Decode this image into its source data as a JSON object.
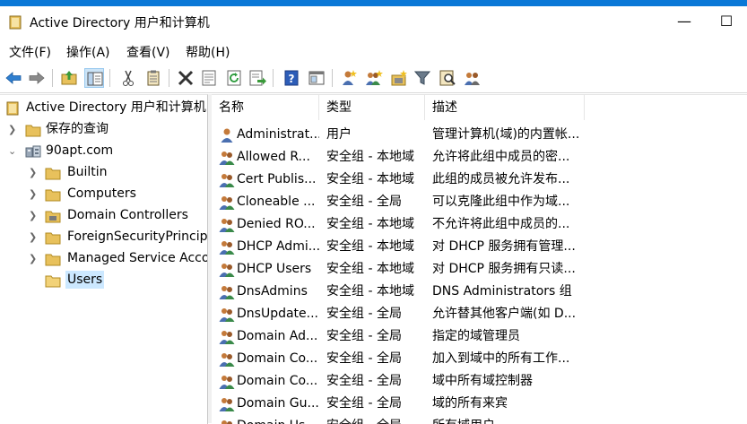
{
  "window": {
    "title": "Active Directory 用户和计算机",
    "minimize_glyph": "—",
    "maximize_glyph": "☐"
  },
  "menu": [
    {
      "label": "文件(F)"
    },
    {
      "label": "操作(A)"
    },
    {
      "label": "查看(V)"
    },
    {
      "label": "帮助(H)"
    }
  ],
  "toolbar": {
    "icons": [
      "back-arrow-icon",
      "forward-arrow-icon",
      "up-folder-icon",
      "show-hide-tree-icon",
      "cut-icon",
      "copy-icon",
      "delete-icon",
      "properties-icon",
      "refresh-icon",
      "export-list-icon",
      "help-icon",
      "console-icon",
      "new-user-icon",
      "new-group-icon",
      "new-ou-icon",
      "filter-icon",
      "find-icon",
      "add-to-group-icon"
    ]
  },
  "tree": {
    "root": "Active Directory 用户和计算机",
    "saved_queries": "保存的查询",
    "domain": "90apt.com",
    "children": [
      {
        "label": "Builtin",
        "selected": false
      },
      {
        "label": "Computers",
        "selected": false
      },
      {
        "label": "Domain Controllers",
        "selected": false
      },
      {
        "label": "ForeignSecurityPrincipals",
        "selected": false
      },
      {
        "label": "Managed Service Accounts",
        "selected": false
      },
      {
        "label": "Users",
        "selected": true
      }
    ]
  },
  "list": {
    "columns": [
      "名称",
      "类型",
      "描述"
    ],
    "rows": [
      {
        "icon": "user-icon",
        "name": "Administrat...",
        "type": "用户",
        "desc": "管理计算机(域)的内置帐..."
      },
      {
        "icon": "group-icon",
        "name": "Allowed R...",
        "type": "安全组 - 本地域",
        "desc": "允许将此组中成员的密..."
      },
      {
        "icon": "group-icon",
        "name": "Cert Publis...",
        "type": "安全组 - 本地域",
        "desc": "此组的成员被允许发布..."
      },
      {
        "icon": "group-icon",
        "name": "Cloneable ...",
        "type": "安全组 - 全局",
        "desc": "可以克隆此组中作为域..."
      },
      {
        "icon": "group-icon",
        "name": "Denied RO...",
        "type": "安全组 - 本地域",
        "desc": "不允许将此组中成员的..."
      },
      {
        "icon": "group-icon",
        "name": "DHCP Admi...",
        "type": "安全组 - 本地域",
        "desc": "对 DHCP 服务拥有管理..."
      },
      {
        "icon": "group-icon",
        "name": "DHCP Users",
        "type": "安全组 - 本地域",
        "desc": "对 DHCP 服务拥有只读..."
      },
      {
        "icon": "group-icon",
        "name": "DnsAdmins",
        "type": "安全组 - 本地域",
        "desc": "DNS Administrators 组"
      },
      {
        "icon": "group-icon",
        "name": "DnsUpdate...",
        "type": "安全组 - 全局",
        "desc": "允许替其他客户端(如 D..."
      },
      {
        "icon": "group-icon",
        "name": "Domain Ad...",
        "type": "安全组 - 全局",
        "desc": "指定的域管理员"
      },
      {
        "icon": "group-icon",
        "name": "Domain Co...",
        "type": "安全组 - 全局",
        "desc": "加入到域中的所有工作..."
      },
      {
        "icon": "group-icon",
        "name": "Domain Co...",
        "type": "安全组 - 全局",
        "desc": "域中所有域控制器"
      },
      {
        "icon": "group-icon",
        "name": "Domain Gu...",
        "type": "安全组 - 全局",
        "desc": "域的所有来宾"
      },
      {
        "icon": "group-icon",
        "name": "Domain Us...",
        "type": "安全组 - 全局",
        "desc": "所有域用户"
      }
    ]
  },
  "colors": {
    "title_accent": "#0a78d7",
    "selection": "#cce8ff",
    "folder": "#e8c15c",
    "user_head": "#c47a3a"
  }
}
